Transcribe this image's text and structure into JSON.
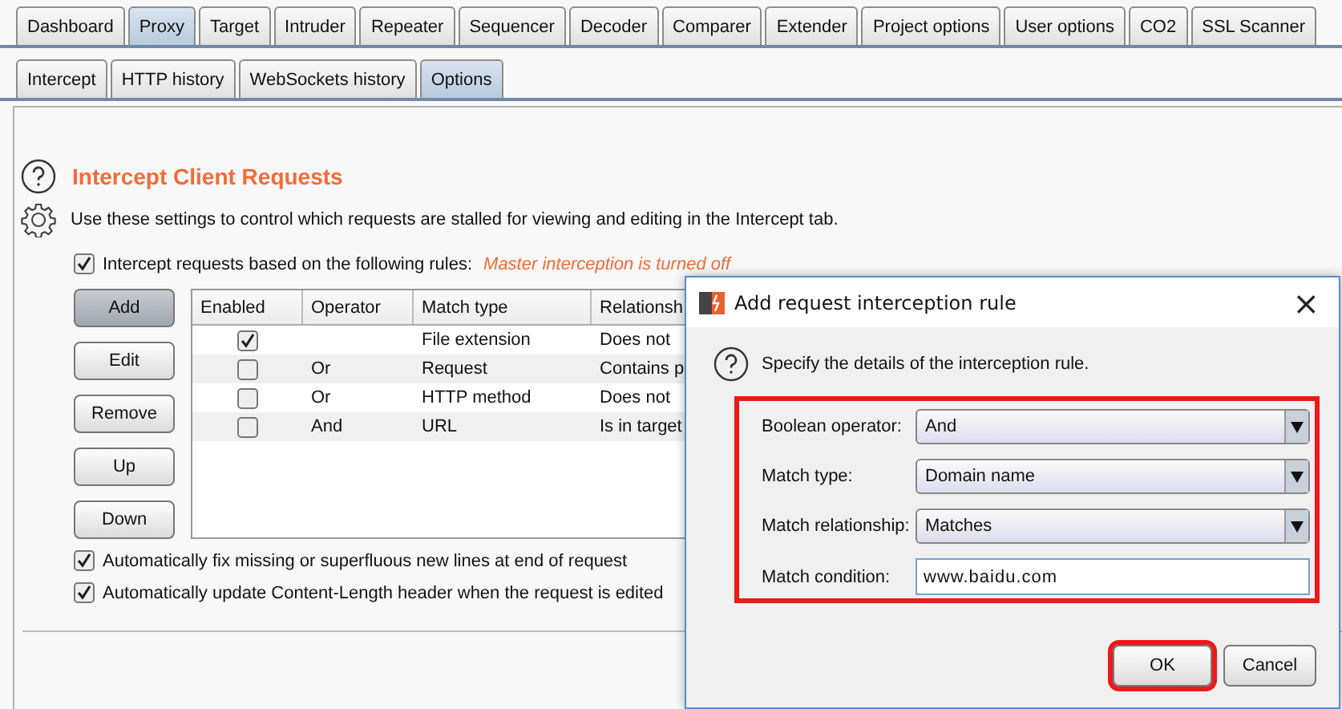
{
  "main_tabs": [
    {
      "label": "Dashboard",
      "selected": false
    },
    {
      "label": "Proxy",
      "selected": true
    },
    {
      "label": "Target",
      "selected": false
    },
    {
      "label": "Intruder",
      "selected": false
    },
    {
      "label": "Repeater",
      "selected": false
    },
    {
      "label": "Sequencer",
      "selected": false
    },
    {
      "label": "Decoder",
      "selected": false
    },
    {
      "label": "Comparer",
      "selected": false
    },
    {
      "label": "Extender",
      "selected": false
    },
    {
      "label": "Project options",
      "selected": false
    },
    {
      "label": "User options",
      "selected": false
    },
    {
      "label": "CO2",
      "selected": false
    },
    {
      "label": "SSL Scanner",
      "selected": false
    }
  ],
  "sub_tabs": [
    {
      "label": "Intercept",
      "selected": false
    },
    {
      "label": "HTTP history",
      "selected": false
    },
    {
      "label": "WebSockets history",
      "selected": false
    },
    {
      "label": "Options",
      "selected": true
    }
  ],
  "section": {
    "title": "Intercept Client Requests",
    "description": "Use these settings to control which requests are stalled for viewing and editing in the Intercept tab.",
    "rules_toggle": {
      "label": "Intercept requests based on the following rules:",
      "checked": true,
      "note": "Master interception is turned off"
    },
    "buttons": [
      {
        "label": "Add",
        "focused": true
      },
      {
        "label": "Edit",
        "focused": false
      },
      {
        "label": "Remove",
        "focused": false
      },
      {
        "label": "Up",
        "focused": false
      },
      {
        "label": "Down",
        "focused": false
      }
    ],
    "table": {
      "columns": [
        "Enabled",
        "Operator",
        "Match type",
        "Relationsh"
      ],
      "rows": [
        {
          "enabled": true,
          "operator": "",
          "match_type": "File extension",
          "relationship": "Does not"
        },
        {
          "enabled": false,
          "operator": "Or",
          "match_type": "Request",
          "relationship": "Contains p"
        },
        {
          "enabled": false,
          "operator": "Or",
          "match_type": "HTTP method",
          "relationship": "Does not"
        },
        {
          "enabled": false,
          "operator": "And",
          "match_type": "URL",
          "relationship": "Is in target"
        }
      ]
    },
    "options": [
      {
        "label": "Automatically fix missing or superfluous new lines at end of request",
        "checked": true
      },
      {
        "label": "Automatically update Content-Length header when the request is edited",
        "checked": true
      }
    ]
  },
  "dialog": {
    "title": "Add request interception rule",
    "close": "×",
    "prompt": "Specify the details of the interception rule.",
    "fields_highlighted": true,
    "fields": [
      {
        "kind": "dropdown",
        "label": "Boolean operator:",
        "value": "And"
      },
      {
        "kind": "dropdown",
        "label": "Match type:",
        "value": "Domain name"
      },
      {
        "kind": "dropdown",
        "label": "Match relationship:",
        "value": "Matches"
      },
      {
        "kind": "text",
        "label": "Match condition:",
        "value": "www.baidu.com"
      }
    ],
    "buttons": [
      {
        "label": "OK",
        "highlighted": true
      },
      {
        "label": "Cancel",
        "highlighted": false
      }
    ]
  }
}
